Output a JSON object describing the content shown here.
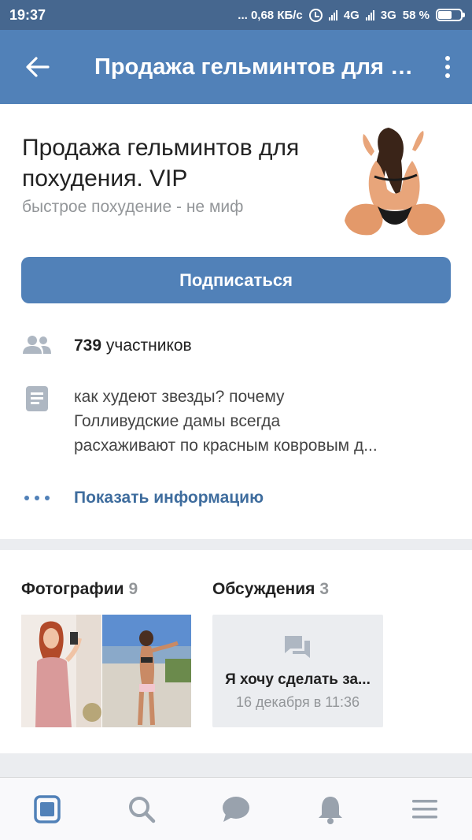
{
  "status_bar": {
    "time": "19:37",
    "network_speed": "... 0,68 КБ/с",
    "net1": "4G",
    "net2": "3G",
    "battery": "58 %",
    "battery_level": 0.58
  },
  "toolbar": {
    "title": "Продажа гельминтов для п...",
    "back_icon": "arrow-left-icon",
    "menu_icon": "more-vertical-icon"
  },
  "group": {
    "name": "Продажа гельминтов для похудения. VIP",
    "status": "быстрое похудение - не миф",
    "subscribe_label": "Подписаться",
    "members_count": "739",
    "members_label": "участников",
    "description_line1": "как худеют звезды? почему",
    "description_line2": "Голливудские дамы всегда",
    "description_line3": "расхаживают по красным ковровым д...",
    "show_info_label": "Показать информацию"
  },
  "photos": {
    "title": "Фотографии",
    "count": "9"
  },
  "discussions": {
    "title": "Обсуждения",
    "count": "3",
    "topic_title": "Я хочу сделать за...",
    "topic_date": "16 декабря в 11:36"
  },
  "bottom_nav": {
    "items": [
      "news-icon",
      "search-icon",
      "messages-icon",
      "notifications-icon",
      "menu-icon"
    ],
    "active_color": "#5181b8",
    "inactive_color": "#99a2ad"
  },
  "colors": {
    "accent": "#5181b8",
    "toolbar": "#5181b8",
    "statusbar": "#46678f"
  }
}
